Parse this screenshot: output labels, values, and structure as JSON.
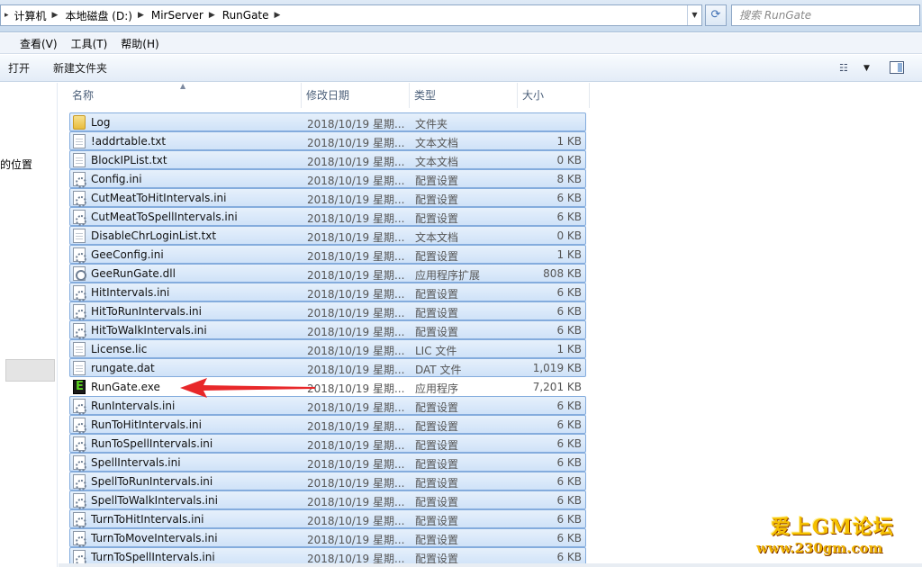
{
  "address": {
    "crumbs": [
      "计算机",
      "本地磁盘 (D:)",
      "MirServer",
      "RunGate"
    ],
    "search_placeholder": "搜索 RunGate"
  },
  "menu": [
    "查看(V)",
    "工具(T)",
    "帮助(H)"
  ],
  "commands": [
    "打开",
    "新建文件夹"
  ],
  "nav": {
    "fragment": "的位置"
  },
  "columns": {
    "name": "名称",
    "date": "修改日期",
    "type": "类型",
    "size": "大小"
  },
  "files": [
    {
      "name": "Log",
      "date": "2018/10/19 星期...",
      "type": "文件夹",
      "size": "",
      "icon": "folder-icon",
      "selected": true
    },
    {
      "name": "!addrtable.txt",
      "date": "2018/10/19 星期...",
      "type": "文本文档",
      "size": "1 KB",
      "icon": "text-file-icon",
      "selected": true
    },
    {
      "name": "BlockIPList.txt",
      "date": "2018/10/19 星期...",
      "type": "文本文档",
      "size": "0 KB",
      "icon": "text-file-icon",
      "selected": true
    },
    {
      "name": "Config.ini",
      "date": "2018/10/19 星期...",
      "type": "配置设置",
      "size": "8 KB",
      "icon": "config-file-icon",
      "selected": true
    },
    {
      "name": "CutMeatToHitIntervals.ini",
      "date": "2018/10/19 星期...",
      "type": "配置设置",
      "size": "6 KB",
      "icon": "config-file-icon",
      "selected": true
    },
    {
      "name": "CutMeatToSpellIntervals.ini",
      "date": "2018/10/19 星期...",
      "type": "配置设置",
      "size": "6 KB",
      "icon": "config-file-icon",
      "selected": true
    },
    {
      "name": "DisableChrLoginList.txt",
      "date": "2018/10/19 星期...",
      "type": "文本文档",
      "size": "0 KB",
      "icon": "text-file-icon",
      "selected": true
    },
    {
      "name": "GeeConfig.ini",
      "date": "2018/10/19 星期...",
      "type": "配置设置",
      "size": "1 KB",
      "icon": "config-file-icon",
      "selected": true
    },
    {
      "name": "GeeRunGate.dll",
      "date": "2018/10/19 星期...",
      "type": "应用程序扩展",
      "size": "808 KB",
      "icon": "dll-file-icon",
      "selected": true
    },
    {
      "name": "HitIntervals.ini",
      "date": "2018/10/19 星期...",
      "type": "配置设置",
      "size": "6 KB",
      "icon": "config-file-icon",
      "selected": true
    },
    {
      "name": "HitToRunIntervals.ini",
      "date": "2018/10/19 星期...",
      "type": "配置设置",
      "size": "6 KB",
      "icon": "config-file-icon",
      "selected": true
    },
    {
      "name": "HitToWalkIntervals.ini",
      "date": "2018/10/19 星期...",
      "type": "配置设置",
      "size": "6 KB",
      "icon": "config-file-icon",
      "selected": true
    },
    {
      "name": "License.lic",
      "date": "2018/10/19 星期...",
      "type": "LIC 文件",
      "size": "1 KB",
      "icon": "generic-file-icon",
      "selected": true
    },
    {
      "name": "rungate.dat",
      "date": "2018/10/19 星期...",
      "type": "DAT 文件",
      "size": "1,019 KB",
      "icon": "data-file-icon",
      "selected": true
    },
    {
      "name": "RunGate.exe",
      "date": "2018/10/19 星期...",
      "type": "应用程序",
      "size": "7,201 KB",
      "icon": "exe-icon",
      "selected": false
    },
    {
      "name": "RunIntervals.ini",
      "date": "2018/10/19 星期...",
      "type": "配置设置",
      "size": "6 KB",
      "icon": "config-file-icon",
      "selected": true
    },
    {
      "name": "RunToHitIntervals.ini",
      "date": "2018/10/19 星期...",
      "type": "配置设置",
      "size": "6 KB",
      "icon": "config-file-icon",
      "selected": true
    },
    {
      "name": "RunToSpellIntervals.ini",
      "date": "2018/10/19 星期...",
      "type": "配置设置",
      "size": "6 KB",
      "icon": "config-file-icon",
      "selected": true
    },
    {
      "name": "SpellIntervals.ini",
      "date": "2018/10/19 星期...",
      "type": "配置设置",
      "size": "6 KB",
      "icon": "config-file-icon",
      "selected": true
    },
    {
      "name": "SpellToRunIntervals.ini",
      "date": "2018/10/19 星期...",
      "type": "配置设置",
      "size": "6 KB",
      "icon": "config-file-icon",
      "selected": true
    },
    {
      "name": "SpellToWalkIntervals.ini",
      "date": "2018/10/19 星期...",
      "type": "配置设置",
      "size": "6 KB",
      "icon": "config-file-icon",
      "selected": true
    },
    {
      "name": "TurnToHitIntervals.ini",
      "date": "2018/10/19 星期...",
      "type": "配置设置",
      "size": "6 KB",
      "icon": "config-file-icon",
      "selected": true
    },
    {
      "name": "TurnToMoveIntervals.ini",
      "date": "2018/10/19 星期...",
      "type": "配置设置",
      "size": "6 KB",
      "icon": "config-file-icon",
      "selected": true
    },
    {
      "name": "TurnToSpellIntervals.ini",
      "date": "2018/10/19 星期...",
      "type": "配置设置",
      "size": "6 KB",
      "icon": "config-file-icon",
      "selected": true
    }
  ],
  "watermark": {
    "line1": "爱上GM论坛",
    "line2": "www.230gm.com"
  },
  "colors": {
    "selection_fill": "#cfe2f8",
    "selection_border": "#84acdd",
    "arrow": "#e8282a",
    "watermark": "#f5c000"
  }
}
